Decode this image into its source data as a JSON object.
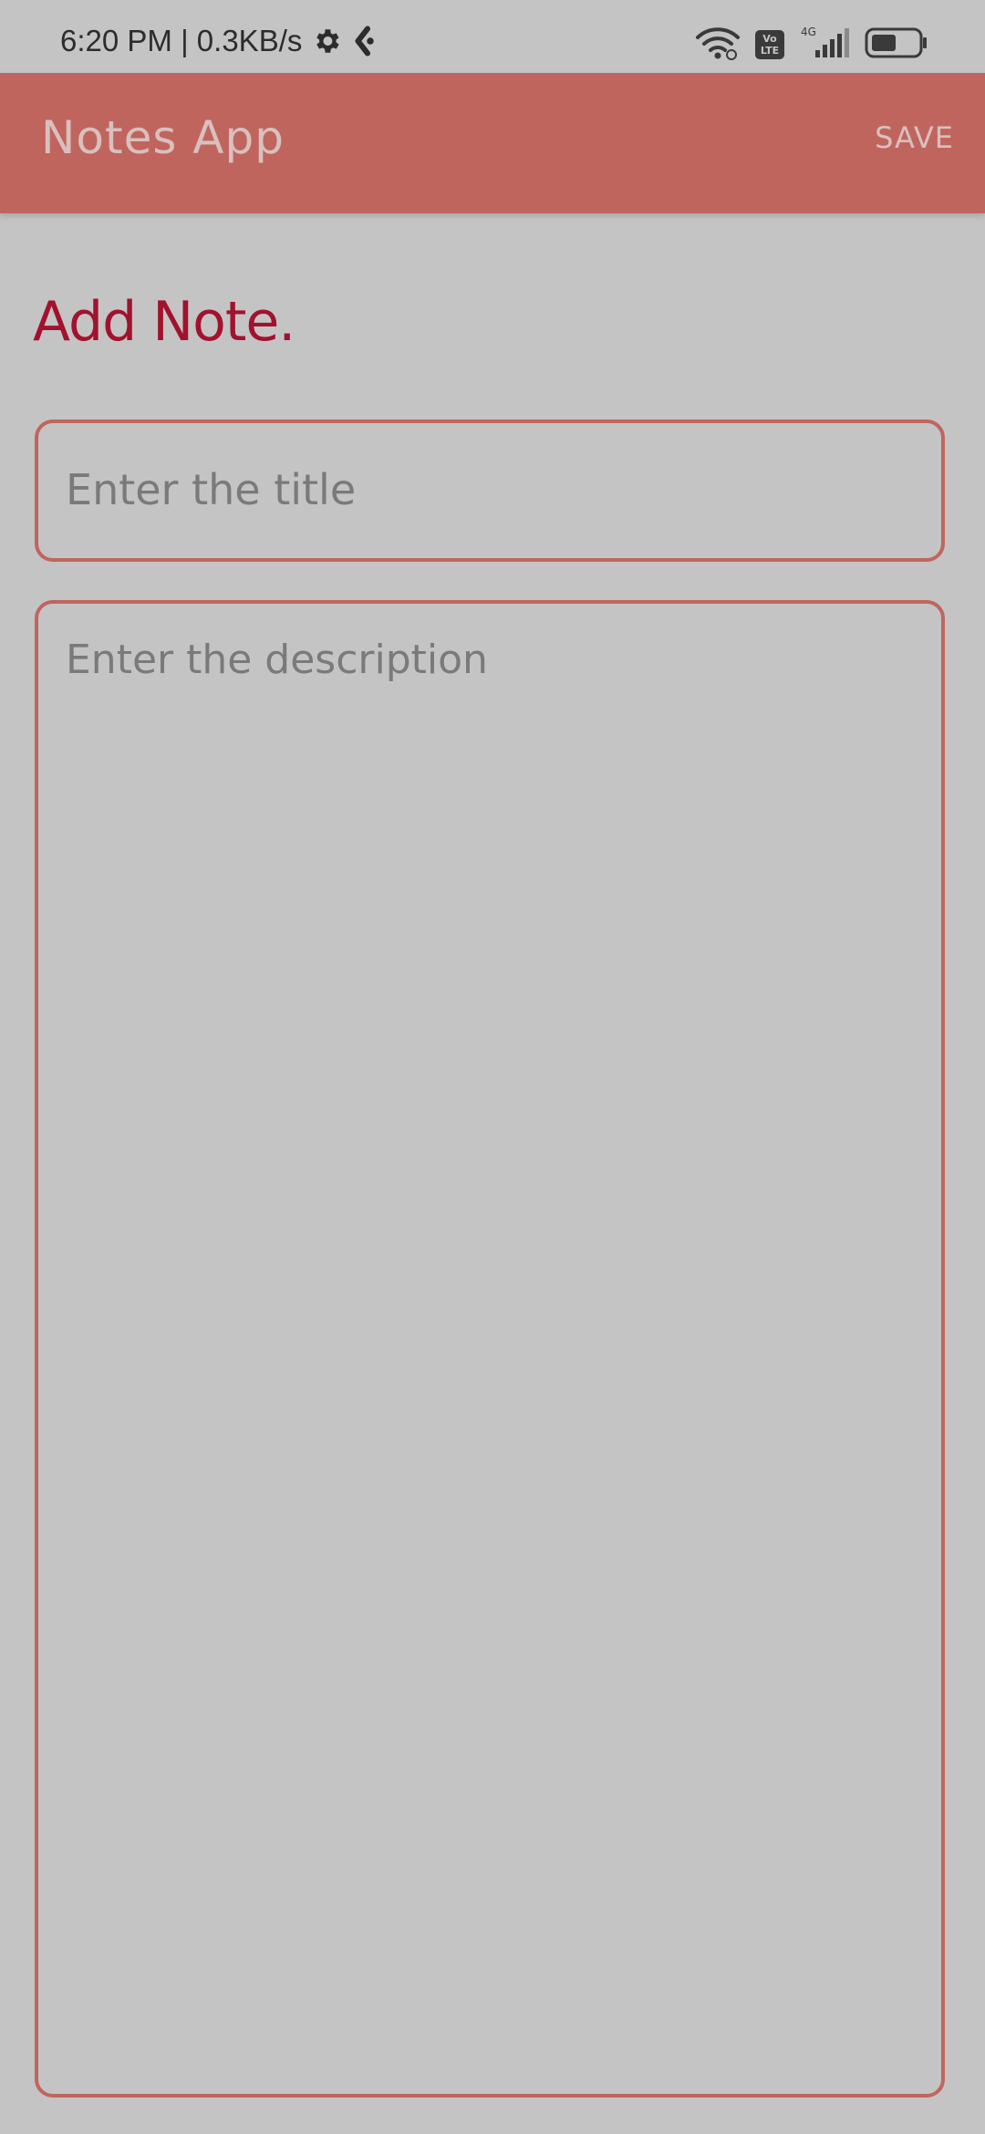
{
  "status_bar": {
    "time_speed": "6:20 PM | 0.3KB/s",
    "volte_label": "Vo\nLTE",
    "network_type": "4G",
    "icons": [
      "settings-gear-icon",
      "app-notification-icon",
      "wifi-icon",
      "volte-icon",
      "signal-icon",
      "battery-icon"
    ]
  },
  "app_bar": {
    "title": "Notes App",
    "save_label": "SAVE"
  },
  "page": {
    "heading": "Add Note."
  },
  "form": {
    "title_placeholder": "Enter the title",
    "title_value": "",
    "description_placeholder": "Enter the description",
    "description_value": ""
  },
  "colors": {
    "accent": "#c0655e",
    "heading": "#a2122e",
    "background": "#c4c4c4"
  }
}
